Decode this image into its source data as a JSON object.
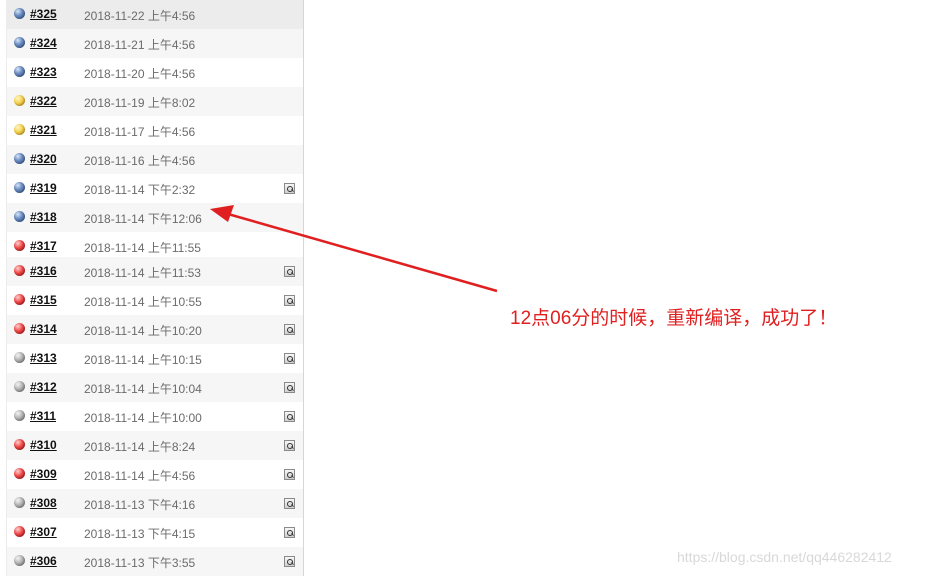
{
  "builds": [
    {
      "number": "#325",
      "date": "2018-11-22 上午4:56",
      "status": "blue",
      "console": false
    },
    {
      "number": "#324",
      "date": "2018-11-21 上午4:56",
      "status": "blue",
      "console": false
    },
    {
      "number": "#323",
      "date": "2018-11-20 上午4:56",
      "status": "blue",
      "console": false
    },
    {
      "number": "#322",
      "date": "2018-11-19 上午8:02",
      "status": "yellow",
      "console": false
    },
    {
      "number": "#321",
      "date": "2018-11-17 上午4:56",
      "status": "yellow",
      "console": false
    },
    {
      "number": "#320",
      "date": "2018-11-16 上午4:56",
      "status": "blue",
      "console": false
    },
    {
      "number": "#319",
      "date": "2018-11-14 下午2:32",
      "status": "blue",
      "console": true
    },
    {
      "number": "#318",
      "date": "2018-11-14 下午12:06",
      "status": "blue",
      "console": false
    },
    {
      "number": "#317",
      "date": "2018-11-14 上午11:55",
      "status": "red",
      "console": false
    },
    {
      "number": "#316",
      "date": "2018-11-14 上午11:53",
      "status": "red",
      "console": true
    },
    {
      "number": "#315",
      "date": "2018-11-14 上午10:55",
      "status": "red",
      "console": true
    },
    {
      "number": "#314",
      "date": "2018-11-14 上午10:20",
      "status": "red",
      "console": true
    },
    {
      "number": "#313",
      "date": "2018-11-14 上午10:15",
      "status": "grey",
      "console": true
    },
    {
      "number": "#312",
      "date": "2018-11-14 上午10:04",
      "status": "grey",
      "console": true
    },
    {
      "number": "#311",
      "date": "2018-11-14 上午10:00",
      "status": "grey",
      "console": true
    },
    {
      "number": "#310",
      "date": "2018-11-14 上午8:24",
      "status": "red",
      "console": true
    },
    {
      "number": "#309",
      "date": "2018-11-14 上午4:56",
      "status": "red",
      "console": true
    },
    {
      "number": "#308",
      "date": "2018-11-13 下午4:16",
      "status": "grey",
      "console": true
    },
    {
      "number": "#307",
      "date": "2018-11-13 下午4:15",
      "status": "red",
      "console": true
    },
    {
      "number": "#306",
      "date": "2018-11-13 下午3:55",
      "status": "grey",
      "console": true
    }
  ],
  "annotation": {
    "text": "12点06分的时候，重新编译，成功了！",
    "color": "#e02020"
  },
  "watermark": "https://blog.csdn.net/qq446282412"
}
